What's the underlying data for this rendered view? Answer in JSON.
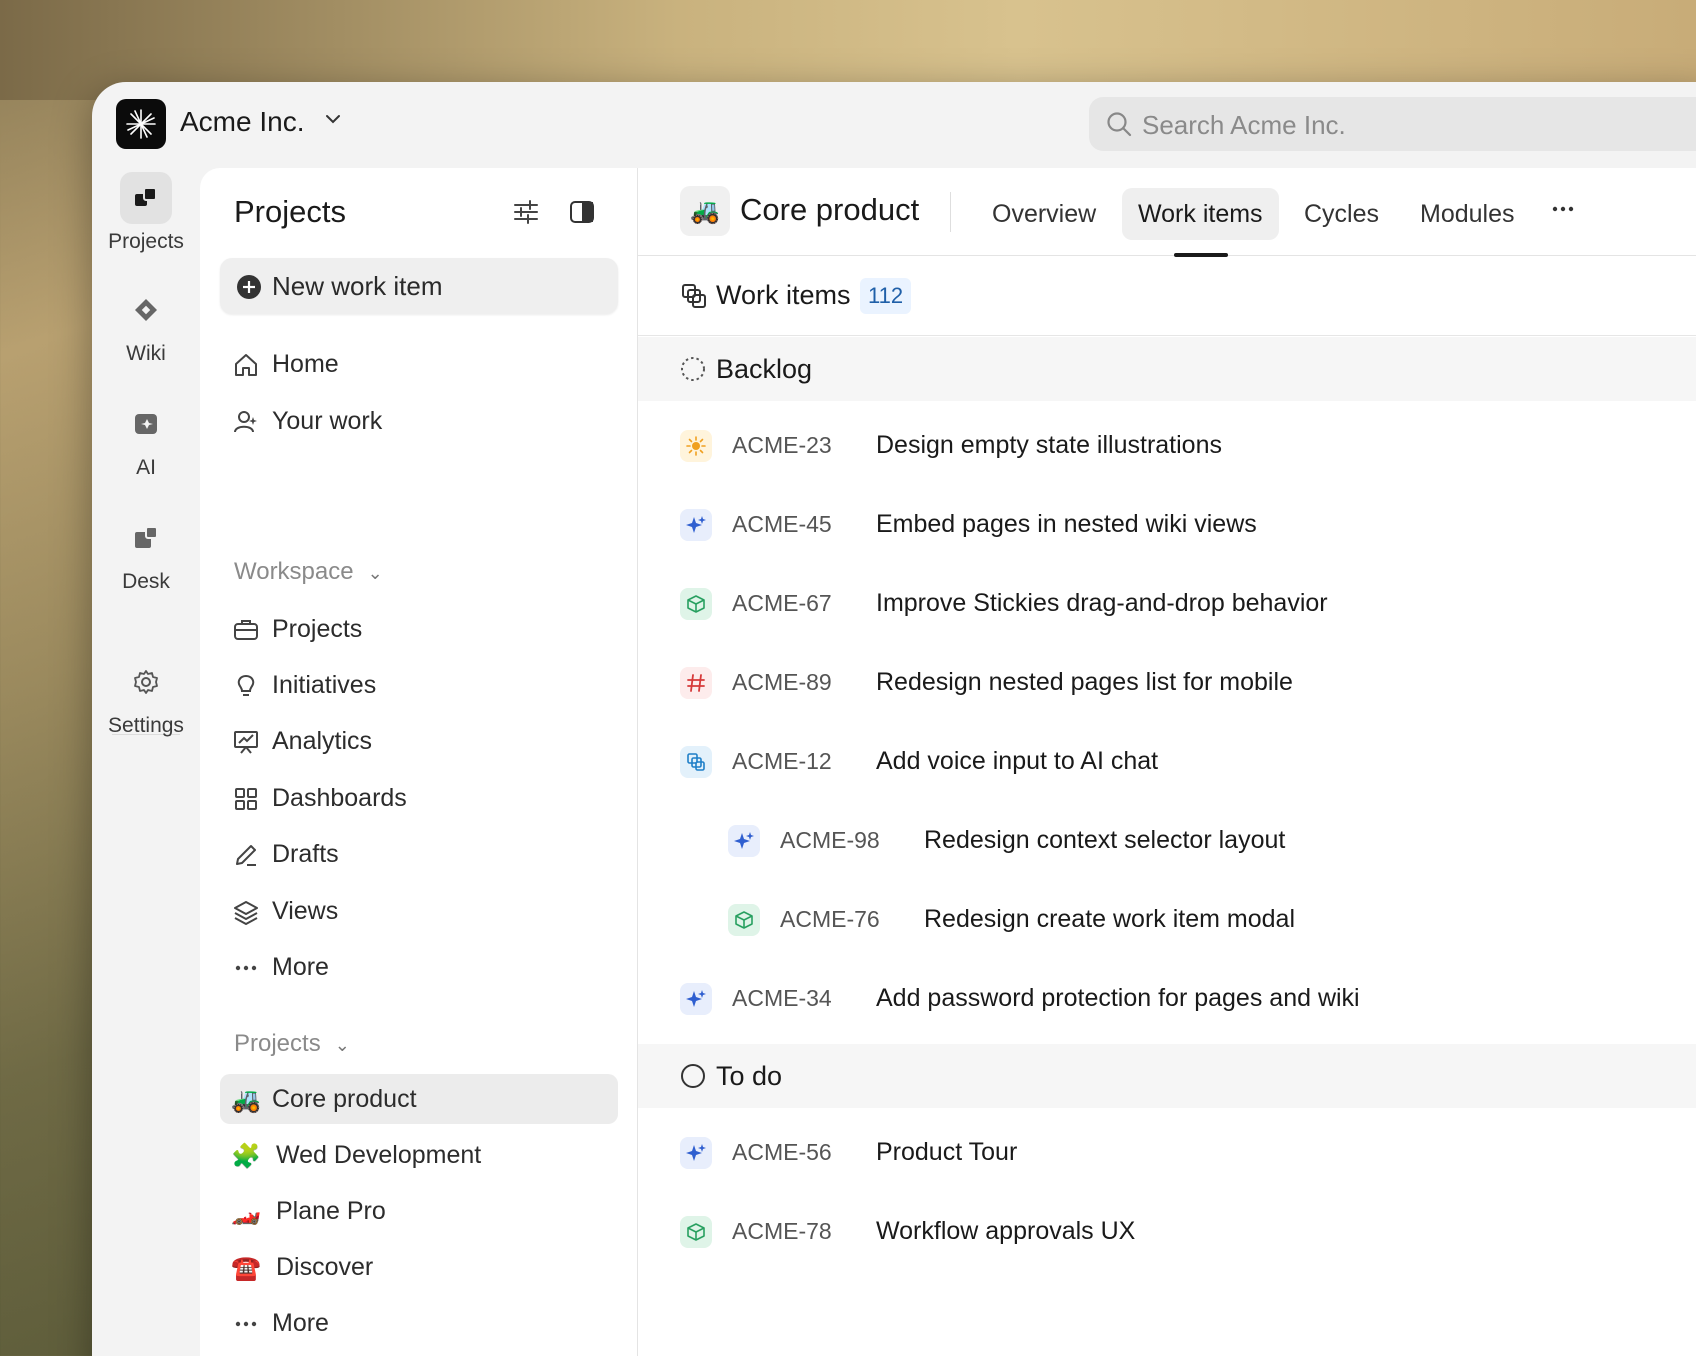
{
  "workspace": {
    "name": "Acme Inc.",
    "search_placeholder": "Search Acme Inc."
  },
  "rail": [
    {
      "label": "Projects",
      "icon": "projects-icon"
    },
    {
      "label": "Wiki",
      "icon": "wiki-icon"
    },
    {
      "label": "AI",
      "icon": "ai-icon"
    },
    {
      "label": "Desk",
      "icon": "desk-icon"
    },
    {
      "label": "Settings",
      "icon": "gear-icon"
    }
  ],
  "sidebar": {
    "title": "Projects",
    "new_item": "New work item",
    "top_items": [
      {
        "label": "Home",
        "icon": "home-icon"
      },
      {
        "label": "Your work",
        "icon": "user-icon"
      }
    ],
    "workspace_header": "Workspace",
    "workspace_items": [
      {
        "label": "Projects",
        "icon": "briefcase-icon"
      },
      {
        "label": "Initiatives",
        "icon": "lightbulb-icon"
      },
      {
        "label": "Analytics",
        "icon": "presentation-chart-icon"
      },
      {
        "label": "Dashboards",
        "icon": "grid-icon"
      },
      {
        "label": "Drafts",
        "icon": "pen-icon"
      },
      {
        "label": "Views",
        "icon": "layers-icon"
      },
      {
        "label": "More",
        "icon": "ellipsis-icon"
      }
    ],
    "projects_header": "Projects",
    "projects": [
      {
        "label": "Core product",
        "emoji": "🚜"
      },
      {
        "label": "Wed Development",
        "emoji": "🧩"
      },
      {
        "label": "Plane Pro",
        "emoji": "🏎️"
      },
      {
        "label": "Discover",
        "emoji": "☎️"
      },
      {
        "label": "More",
        "emoji": "···"
      }
    ]
  },
  "project": {
    "emoji": "🚜",
    "title": "Core product",
    "tabs": [
      "Overview",
      "Work items",
      "Cycles",
      "Modules"
    ],
    "active_tab": "Work items"
  },
  "work_items": {
    "title": "Work items",
    "count": "112",
    "groups": [
      {
        "name": "Backlog",
        "state_icon": "backlog-dashed-circle-icon",
        "items": [
          {
            "id": "ACME-23",
            "title": "Design empty state illustrations",
            "type_icon": "sun-icon",
            "icon_color": "#f0a020",
            "icon_bg": "#fff4dc",
            "level": 0
          },
          {
            "id": "ACME-45",
            "title": "Embed pages in nested wiki views",
            "type_icon": "sparkle-icon",
            "icon_color": "#2f5fd0",
            "icon_bg": "#e8eefc",
            "level": 0
          },
          {
            "id": "ACME-67",
            "title": "Improve Stickies drag-and-drop behavior",
            "type_icon": "cube-icon",
            "icon_color": "#28a060",
            "icon_bg": "#dff4e8",
            "level": 0
          },
          {
            "id": "ACME-89",
            "title": "Redesign nested pages list for mobile",
            "type_icon": "hash-icon",
            "icon_color": "#d63a3a",
            "icon_bg": "#fdecec",
            "level": 0
          },
          {
            "id": "ACME-12",
            "title": "Add voice input to AI chat",
            "type_icon": "copy-blocks-icon",
            "icon_color": "#1f7fc8",
            "icon_bg": "#e3f1fb",
            "level": 0
          },
          {
            "id": "ACME-98",
            "title": "Redesign context selector layout",
            "type_icon": "sparkle-icon",
            "icon_color": "#2f5fd0",
            "icon_bg": "#e8eefc",
            "level": 1
          },
          {
            "id": "ACME-76",
            "title": "Redesign create work item modal",
            "type_icon": "cube-icon",
            "icon_color": "#28a060",
            "icon_bg": "#dff4e8",
            "level": 1
          },
          {
            "id": "ACME-34",
            "title": "Add password protection for pages and wiki",
            "type_icon": "sparkle-icon",
            "icon_color": "#2f5fd0",
            "icon_bg": "#e8eefc",
            "level": 0
          }
        ]
      },
      {
        "name": "To do",
        "state_icon": "todo-circle-icon",
        "items": [
          {
            "id": "ACME-56",
            "title": "Product Tour",
            "type_icon": "sparkle-icon",
            "icon_color": "#2f5fd0",
            "icon_bg": "#e8eefc",
            "level": 0
          },
          {
            "id": "ACME-78",
            "title": "Workflow approvals UX",
            "type_icon": "cube-icon",
            "icon_color": "#28a060",
            "icon_bg": "#dff4e8",
            "level": 0
          }
        ]
      }
    ]
  }
}
